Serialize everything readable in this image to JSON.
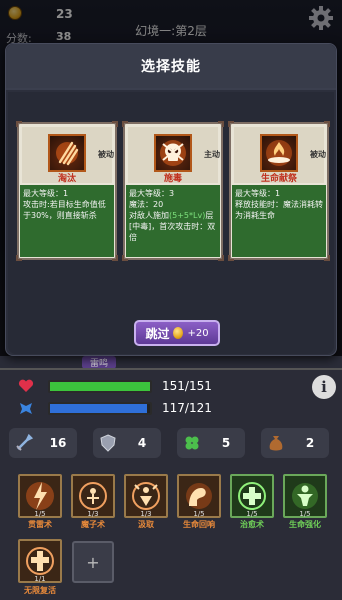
{
  "hud": {
    "coins": "23",
    "score_label": "分数:",
    "score_value": "38",
    "stage_title": "幻境一:第2层"
  },
  "modal": {
    "title": "选择技能",
    "skills": [
      {
        "name": "淘汰",
        "type": "被动",
        "icon": "claw-slash-icon",
        "name_color": "#c0301e",
        "desc": [
          {
            "t": "最大等级：1"
          },
          {
            "t": "攻击时:若目标生命值低于30%，则直接斩杀"
          }
        ]
      },
      {
        "name": "施毒",
        "type": "主动",
        "icon": "skull-icon",
        "name_color": "#c0301e",
        "desc": [
          {
            "t": "最大等级：3"
          },
          {
            "t": "魔法：20"
          },
          {
            "t": "对敌人施加",
            "hl": "(5+5*Lv)",
            "tail": "层[中毒]，首次攻击时：双倍"
          }
        ]
      },
      {
        "name": "生命献祭",
        "type": "被动",
        "icon": "fire-altar-icon",
        "name_color": "#c0301e",
        "desc": [
          {
            "t": "最大等级：1"
          },
          {
            "t": "释放技能时：魔法消耗转为消耗生命"
          }
        ]
      }
    ],
    "skip": {
      "label": "跳过",
      "cost": "+20"
    }
  },
  "under_label": "雷鸣",
  "player": {
    "hp_text": "151/151",
    "hp_fraction": 1.0,
    "mp_text": "117/121",
    "mp_fraction": 0.967,
    "hp_color": "#3cc43c",
    "mp_color": "#2f6fd8"
  },
  "stats": [
    {
      "icon": "sword-icon",
      "value": "16"
    },
    {
      "icon": "shield-icon",
      "value": "4"
    },
    {
      "icon": "clover-icon",
      "value": "5"
    },
    {
      "icon": "money-bag-icon",
      "value": "2"
    }
  ],
  "owned_skills": [
    {
      "name": "贯雷术",
      "level": "1/5",
      "icon": "lightning-burst-icon",
      "green": false
    },
    {
      "name": "魔子术",
      "level": "1/3",
      "icon": "rune-circle-icon",
      "green": false
    },
    {
      "name": "汲取",
      "level": "1/3",
      "icon": "drain-icon",
      "green": false
    },
    {
      "name": "生命回响",
      "level": "1/5",
      "icon": "heal-arm-icon",
      "green": false
    },
    {
      "name": "治愈术",
      "level": "1/5",
      "icon": "cross-heal-icon",
      "green": true
    },
    {
      "name": "生命强化",
      "level": "1/5",
      "icon": "life-boost-icon",
      "green": true
    },
    {
      "name": "无限复活",
      "level": "1/1",
      "icon": "revive-icon",
      "green": false
    }
  ],
  "add_slot": "+"
}
